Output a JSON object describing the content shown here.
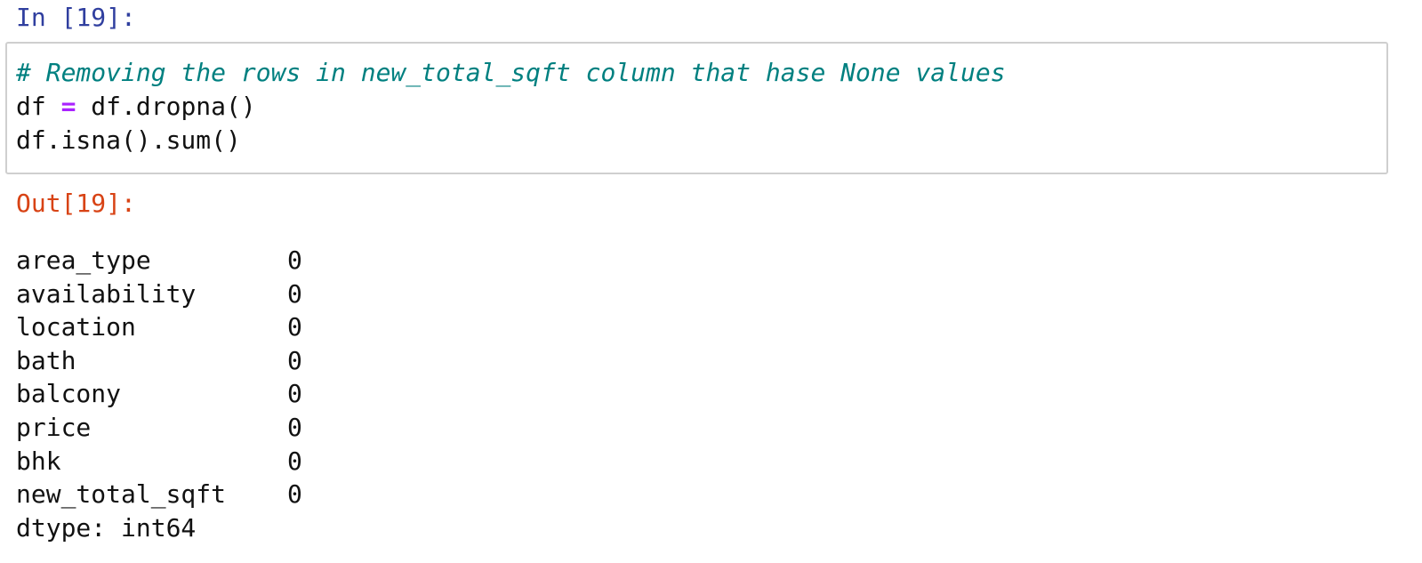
{
  "cell": {
    "input_prompt": "In [19]:",
    "code": {
      "comment": "# Removing the rows in new_total_sqft column that hase None values",
      "line2_left": "df ",
      "line2_op": "=",
      "line2_right": " df.dropna()",
      "line3": "df.isna().sum()"
    },
    "output_prompt": "Out[19]:",
    "output": {
      "rows": [
        {
          "name": "area_type",
          "value": "0"
        },
        {
          "name": "availability",
          "value": "0"
        },
        {
          "name": "location",
          "value": "0"
        },
        {
          "name": "bath",
          "value": "0"
        },
        {
          "name": "balcony",
          "value": "0"
        },
        {
          "name": "price",
          "value": "0"
        },
        {
          "name": "bhk",
          "value": "0"
        },
        {
          "name": "new_total_sqft",
          "value": "0"
        }
      ],
      "dtype_line": "dtype: int64"
    }
  },
  "colors": {
    "input_prompt": "#303f9f",
    "output_prompt": "#d84315",
    "comment": "#008080",
    "operator": "#aa22ff",
    "cell_border": "#cfcfcf"
  }
}
